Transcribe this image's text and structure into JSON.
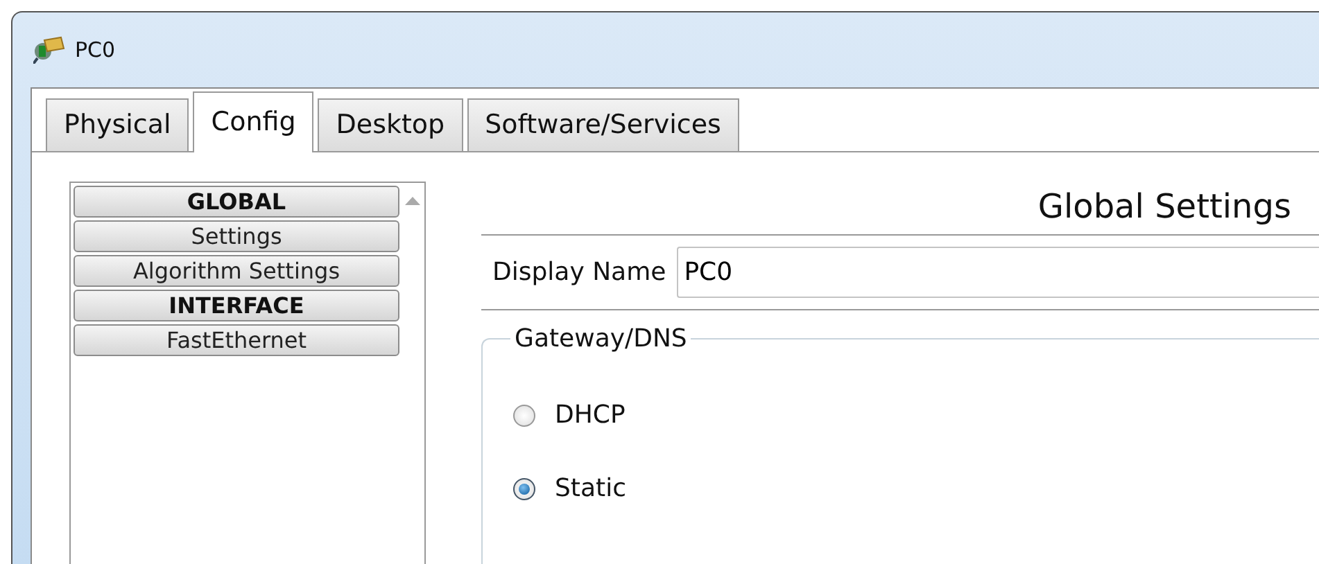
{
  "window": {
    "title": "PC0"
  },
  "tabs": [
    {
      "label": "Physical",
      "selected": false
    },
    {
      "label": "Config",
      "selected": true
    },
    {
      "label": "Desktop",
      "selected": false
    },
    {
      "label": "Software/Services",
      "selected": false
    }
  ],
  "sidebar": {
    "items": [
      {
        "label": "GLOBAL",
        "kind": "header"
      },
      {
        "label": "Settings",
        "kind": "item"
      },
      {
        "label": "Algorithm Settings",
        "kind": "item"
      },
      {
        "label": "INTERFACE",
        "kind": "header"
      },
      {
        "label": "FastEthernet",
        "kind": "item"
      }
    ]
  },
  "panel": {
    "title": "Global Settings",
    "display_name": {
      "label": "Display Name",
      "value": "PC0"
    },
    "group": {
      "title": "Gateway/DNS",
      "options": [
        {
          "label": "DHCP",
          "selected": false
        },
        {
          "label": "Static",
          "selected": true
        }
      ]
    }
  }
}
